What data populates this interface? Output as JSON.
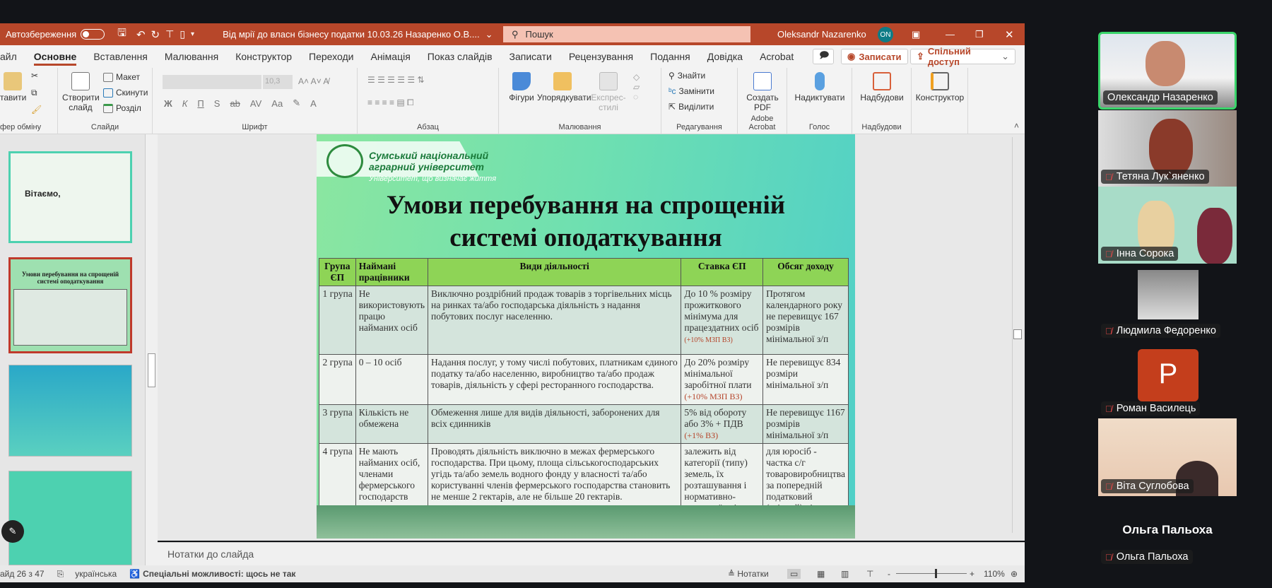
{
  "titlebar": {
    "autosave": "Автозбереження",
    "doc_title": "Від мрії до власн бізнесу податки 10.03.26 Назаренко О.В....",
    "search_placeholder": "Пошук",
    "user": "Oleksandr Nazarenko",
    "user_initials": "ON",
    "accent": "#b7472a"
  },
  "tabs": [
    {
      "label": "айл"
    },
    {
      "label": "Основне"
    },
    {
      "label": "Вставлення"
    },
    {
      "label": "Малювання"
    },
    {
      "label": "Конструктор"
    },
    {
      "label": "Переходи"
    },
    {
      "label": "Анімація"
    },
    {
      "label": "Показ слайдів"
    },
    {
      "label": "Записати"
    },
    {
      "label": "Рецензування"
    },
    {
      "label": "Подання"
    },
    {
      "label": "Довідка"
    },
    {
      "label": "Acrobat"
    }
  ],
  "tab_buttons": {
    "record": "Записати",
    "share": "Спільний доступ"
  },
  "ribbon": {
    "clipboard": {
      "paste": "тавити",
      "label": "фер обміну"
    },
    "slides": {
      "new_slide": "Створити слайд",
      "layout": "Макет",
      "reset": "Скинути",
      "section": "Розділ",
      "label": "Слайди"
    },
    "font": {
      "size": "10,3",
      "label": "Шрифт",
      "bold": "Ж",
      "italic": "К",
      "underline": "П",
      "strike": "S"
    },
    "paragraph": {
      "label": "Абзац"
    },
    "drawing": {
      "shapes": "Фігури",
      "arrange": "Упорядкувати",
      "styles": "Експрес-стилі",
      "label": "Малювання"
    },
    "editing": {
      "find": "Знайти",
      "replace": "Замінити",
      "select": "Виділити",
      "label": "Редагування"
    },
    "acrobat": {
      "create_pdf": "Создать PDF",
      "label": "Adobe Acrobat"
    },
    "voice": {
      "dictate": "Надиктувати",
      "label": "Голос"
    },
    "addins": {
      "addins": "Надбудови",
      "label": "Надбудови"
    },
    "designer": {
      "label": "Конструктор"
    }
  },
  "thumbs": {
    "t1_text": "Вітаємо,",
    "t2_title": "Умови перебування на спрощеній системі оподаткування"
  },
  "slide": {
    "logo_line1": "Сумський національний",
    "logo_line2": "аграрний університет",
    "tagline": "Університет, що визначає життя",
    "title": "Умови перебування на спрощеній системі оподаткування",
    "headers": [
      "Група ЄП",
      "Наймані працівники",
      "Види діяльності",
      "Ставка ЄП",
      "Обсяг доходу"
    ],
    "rows": [
      {
        "group": "1 група",
        "workers": "Не використовують працю найманих осіб",
        "activity": "Виключно роздрібний продаж товарів з торгівельних місць на ринках та/або господарська діяльність з надання побутових послуг населенню.",
        "rate": "До 10 % розміру прожиткового мінімума для працездатних осіб",
        "rate_note": "(+10% МЗП ВЗ)",
        "income": "Протягом календарного року не перевищує 167 розмірів мінімальної з/п"
      },
      {
        "group": "2 група",
        "workers": "0 – 10 осіб",
        "activity": "Надання послуг, у тому числі побутових, платникам єдиного податку та/або населенню, виробництво та/або продаж товарів, діяльність у сфері ресторанного господарства.",
        "rate": "До 20% розміру мінімальної заробітної плати",
        "rate_note": "(+10% МЗП ВЗ)",
        "income": "Не перевищує 834 розміри мінімальної з/п"
      },
      {
        "group": "3 група",
        "workers": "Кількість не обмежена",
        "activity": "Обмеження лише для видів діяльності, заборонених для всіх єдинників",
        "rate": "5% від обороту або 3% + ПДВ",
        "rate_note": "(+1% ВЗ)",
        "income": "Не перевищує 1167 розмірів мінімальної з/п"
      },
      {
        "group": "4 група",
        "workers": "Не мають найманих осіб, членами фермерського господарств",
        "activity": "Проводять діяльність виключно в межах фермерського господарства. При цьому, площа сільськогосподарських угідь та/або земель водного фонду у власності та/або користуванні членів фермерського господарства становить не менше 2 гектарів, але не більше 20 гектарів.",
        "rate": "залежить від категорії (типу) земель, їх розташування і нормативно-грошової оцінки землі",
        "rate_note": "",
        "income": "для юросіб - частка с/г товаровиробництва за попередній податковий (звітний) рік"
      }
    ]
  },
  "notes_placeholder": "Нотатки до слайда",
  "status": {
    "slide": "айд 26 з 47",
    "language": "українська",
    "accessibility": "Спеціальні можливості: щось не так",
    "notes": "Нотатки",
    "zoom": "110%",
    "zoom_fraction": 0.55
  },
  "participants": [
    {
      "name": "Олександр Назаренко",
      "muted": false,
      "active": true
    },
    {
      "name": "Тетяна Лук`яненко",
      "muted": true
    },
    {
      "name": "Інна Сорока",
      "muted": true
    },
    {
      "name": "Людмила Федоренко",
      "muted": true
    },
    {
      "name": "Роман Василець",
      "muted": true,
      "initial": "P"
    },
    {
      "name": "Віта Суглобова",
      "muted": true
    },
    {
      "name": "Ольга Пальоха",
      "muted": true,
      "big_name": "Ольга Пальоха"
    }
  ]
}
